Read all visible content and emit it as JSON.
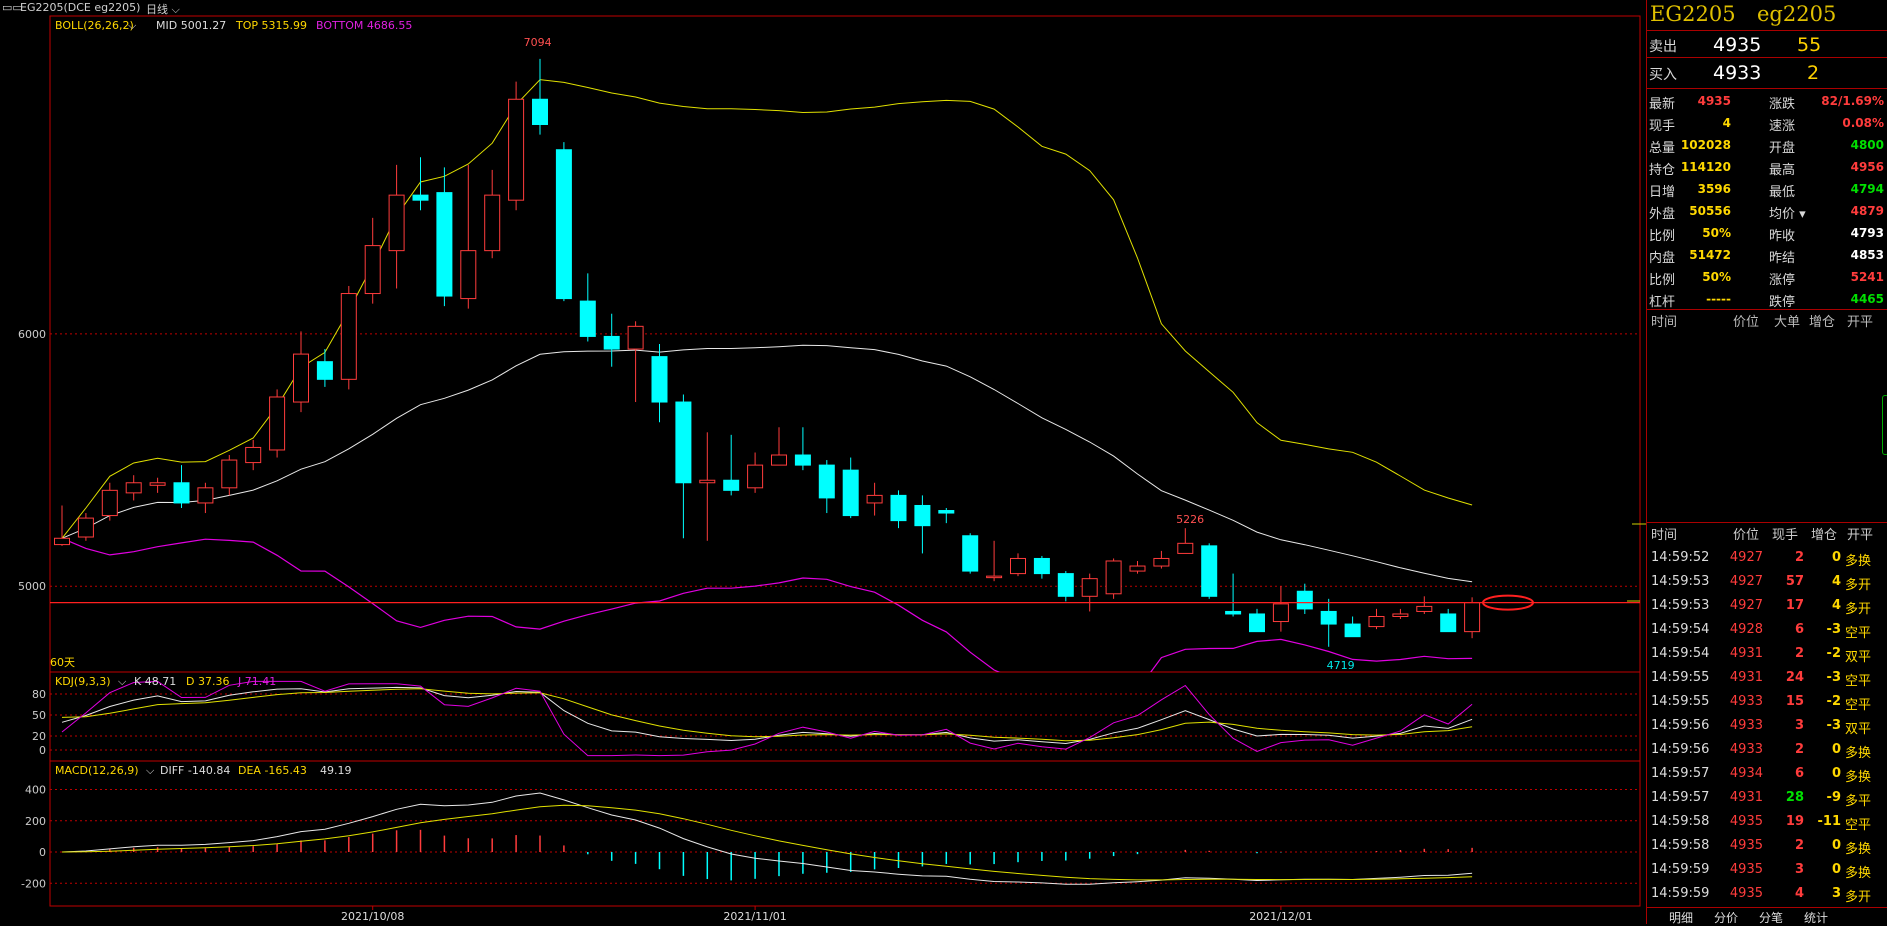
{
  "window": {
    "symbol_line": "EG2205(DCE eg2205)",
    "period": "日线"
  },
  "colors": {
    "up": "#ff3c3c",
    "down": "#00ffff",
    "mid": "#e8e8e8",
    "top": "#e0e000",
    "bottom": "#e000e0",
    "grid": "#c00000",
    "label_yellow": "#ffd800",
    "label_green": "#00e000"
  },
  "chart_data": {
    "type": "candlestick",
    "x_labels": [
      {
        "i": 13,
        "label": "2021/10/08"
      },
      {
        "i": 29,
        "label": "2021/11/01"
      },
      {
        "i": 51,
        "label": "2021/12/01"
      }
    ],
    "price_axis": {
      "ticks": [
        "6000",
        "5000"
      ],
      "range": [
        4660,
        7260
      ]
    },
    "boll": {
      "title": "BOLL(26,26,2)",
      "mid_label": "MID 5001.27",
      "top_label": "TOP 5315.99",
      "bottom_label": "BOTTOM 4686.55"
    },
    "annotations": {
      "high": "7094",
      "high2": "5226",
      "low": "4719"
    },
    "bottom_note": "60天",
    "candles": [
      [
        5165,
        5190,
        5320,
        5160
      ],
      [
        5195,
        5270,
        5290,
        5180
      ],
      [
        5280,
        5380,
        5410,
        5260
      ],
      [
        5370,
        5410,
        5440,
        5340
      ],
      [
        5400,
        5410,
        5430,
        5370
      ],
      [
        5410,
        5330,
        5480,
        5310
      ],
      [
        5330,
        5390,
        5410,
        5290
      ],
      [
        5390,
        5500,
        5520,
        5360
      ],
      [
        5490,
        5550,
        5580,
        5460
      ],
      [
        5540,
        5750,
        5780,
        5510
      ],
      [
        5730,
        5920,
        6010,
        5690
      ],
      [
        5890,
        5820,
        5940,
        5790
      ],
      [
        5820,
        6160,
        6190,
        5780
      ],
      [
        6160,
        6350,
        6460,
        6120
      ],
      [
        6330,
        6550,
        6670,
        6180
      ],
      [
        6550,
        6530,
        6700,
        6490
      ],
      [
        6560,
        6150,
        6660,
        6110
      ],
      [
        6140,
        6330,
        6670,
        6100
      ],
      [
        6330,
        6550,
        6650,
        6300
      ],
      [
        6530,
        6930,
        7000,
        6490
      ],
      [
        6930,
        6830,
        7090,
        6790
      ],
      [
        6730,
        6140,
        6760,
        6130
      ],
      [
        6130,
        5990,
        6240,
        5970
      ],
      [
        5990,
        5940,
        6080,
        5870
      ],
      [
        5940,
        6030,
        6050,
        5730
      ],
      [
        5910,
        5730,
        5960,
        5650
      ],
      [
        5730,
        5410,
        5760,
        5190
      ],
      [
        5410,
        5420,
        5610,
        5180
      ],
      [
        5420,
        5380,
        5600,
        5360
      ],
      [
        5390,
        5480,
        5530,
        5370
      ],
      [
        5480,
        5520,
        5630,
        5490
      ],
      [
        5520,
        5480,
        5630,
        5460
      ],
      [
        5480,
        5350,
        5500,
        5290
      ],
      [
        5460,
        5280,
        5510,
        5270
      ],
      [
        5330,
        5360,
        5410,
        5280
      ],
      [
        5360,
        5260,
        5380,
        5230
      ],
      [
        5320,
        5240,
        5360,
        5130
      ],
      [
        5300,
        5290,
        5310,
        5250
      ],
      [
        5200,
        5060,
        5210,
        5050
      ],
      [
        5040,
        5040,
        5180,
        5020
      ],
      [
        5050,
        5110,
        5130,
        5040
      ],
      [
        5110,
        5050,
        5120,
        5030
      ],
      [
        5050,
        4960,
        5060,
        4940
      ],
      [
        4960,
        5030,
        5050,
        4900
      ],
      [
        4970,
        5100,
        5110,
        4950
      ],
      [
        5060,
        5080,
        5100,
        5050
      ],
      [
        5080,
        5110,
        5140,
        5070
      ],
      [
        5130,
        5170,
        5230,
        5130
      ],
      [
        5160,
        4960,
        5170,
        4950
      ],
      [
        4900,
        4890,
        5050,
        4880
      ],
      [
        4890,
        4820,
        4910,
        4820
      ],
      [
        4860,
        4930,
        5000,
        4820
      ],
      [
        4980,
        4910,
        5010,
        4890
      ],
      [
        4900,
        4850,
        4950,
        4760
      ],
      [
        4850,
        4800,
        4880,
        4800
      ],
      [
        4840,
        4880,
        4910,
        4830
      ],
      [
        4880,
        4890,
        4910,
        4870
      ],
      [
        4900,
        4920,
        4960,
        4890
      ],
      [
        4890,
        4820,
        4910,
        4820
      ],
      [
        4820,
        4935,
        4956,
        4794
      ]
    ],
    "kdj": {
      "title": "KDJ(9,3,3)",
      "k_label": "K 48.71",
      "d_label": "D 37.36",
      "j_label": "J 71.41",
      "ticks": [
        "80",
        "50",
        "20",
        "0"
      ],
      "range": [
        -10,
        100
      ]
    },
    "macd": {
      "title": "MACD(12,26,9)",
      "diff_label": "DIFF -140.84",
      "dea_label": "DEA -165.43",
      "macd_label": "49.19",
      "ticks": [
        "400",
        "200",
        "0",
        "-200"
      ],
      "range": [
        -320,
        480
      ]
    }
  },
  "quote": {
    "code": "EG2205",
    "name": "eg2205",
    "sell_label": "卖出",
    "sell_price": "4935",
    "sell_vol": "55",
    "buy_label": "买入",
    "buy_price": "4933",
    "buy_vol": "2",
    "stats": [
      {
        "l": "最新",
        "v": "4935",
        "c": "red",
        "l2": "涨跌",
        "v2": "82/1.69%",
        "c2": "red"
      },
      {
        "l": "现手",
        "v": "4",
        "c": "ylw",
        "l2": "速涨",
        "v2": "0.08%",
        "c2": "red"
      },
      {
        "l": "总量",
        "v": "102028",
        "c": "ylw",
        "l2": "开盘",
        "v2": "4800",
        "c2": "grn"
      },
      {
        "l": "持仓",
        "v": "114120",
        "c": "ylw",
        "l2": "最高",
        "v2": "4956",
        "c2": "red"
      },
      {
        "l": "日增",
        "v": "3596",
        "c": "ylw",
        "l2": "最低",
        "v2": "4794",
        "c2": "grn"
      },
      {
        "l": "外盘",
        "v": "50556",
        "c": "ylw",
        "l2": "均价",
        "v2": "4879",
        "c2": "red"
      },
      {
        "l": "比例",
        "v": "50%",
        "c": "ylw",
        "l2": "昨收",
        "v2": "4793",
        "c2": "wht"
      },
      {
        "l": "内盘",
        "v": "51472",
        "c": "ylw",
        "l2": "昨结",
        "v2": "4853",
        "c2": "wht"
      },
      {
        "l": "比例",
        "v": "50%",
        "c": "ylw",
        "l2": "涨停",
        "v2": "5241",
        "c2": "red"
      },
      {
        "l": "杠杆",
        "v": "-----",
        "c": "ylw",
        "l2": "跌停",
        "v2": "4465",
        "c2": "grn"
      }
    ],
    "big_header": {
      "time": "时间",
      "price": "价位",
      "big": "大单",
      "oi": "增仓",
      "open": "开平"
    },
    "tick_header": {
      "time": "时间",
      "price": "价位",
      "hand": "现手",
      "oi": "增仓",
      "open": "开平"
    },
    "ticks": [
      {
        "t": "14:59:52",
        "p": "4927",
        "h": "2",
        "hc": "red",
        "o": "0",
        "oc": "ylw",
        "k": "多换",
        "kc": "ylw"
      },
      {
        "t": "14:59:53",
        "p": "4927",
        "h": "57",
        "hc": "red",
        "o": "4",
        "oc": "ylw",
        "k": "多开",
        "kc": "ylw"
      },
      {
        "t": "14:59:53",
        "p": "4927",
        "h": "17",
        "hc": "red",
        "o": "4",
        "oc": "ylw",
        "k": "多开",
        "kc": "ylw"
      },
      {
        "t": "14:59:54",
        "p": "4928",
        "h": "6",
        "hc": "red",
        "o": "-3",
        "oc": "ylw",
        "k": "空平",
        "kc": "ylw"
      },
      {
        "t": "14:59:54",
        "p": "4931",
        "h": "2",
        "hc": "red",
        "o": "-2",
        "oc": "ylw",
        "k": "双平",
        "kc": "ylw"
      },
      {
        "t": "14:59:55",
        "p": "4931",
        "h": "24",
        "hc": "red",
        "o": "-3",
        "oc": "ylw",
        "k": "空平",
        "kc": "ylw"
      },
      {
        "t": "14:59:55",
        "p": "4933",
        "h": "15",
        "hc": "red",
        "o": "-2",
        "oc": "ylw",
        "k": "空平",
        "kc": "ylw"
      },
      {
        "t": "14:59:56",
        "p": "4933",
        "h": "3",
        "hc": "red",
        "o": "-3",
        "oc": "ylw",
        "k": "双平",
        "kc": "ylw"
      },
      {
        "t": "14:59:56",
        "p": "4933",
        "h": "2",
        "hc": "red",
        "o": "0",
        "oc": "ylw",
        "k": "多换",
        "kc": "ylw"
      },
      {
        "t": "14:59:57",
        "p": "4934",
        "h": "6",
        "hc": "red",
        "o": "0",
        "oc": "ylw",
        "k": "多换",
        "kc": "ylw"
      },
      {
        "t": "14:59:57",
        "p": "4931",
        "h": "28",
        "hc": "grn",
        "o": "-9",
        "oc": "ylw",
        "k": "多平",
        "kc": "ylw"
      },
      {
        "t": "14:59:58",
        "p": "4935",
        "h": "19",
        "hc": "red",
        "o": "-11",
        "oc": "ylw",
        "k": "空平",
        "kc": "ylw"
      },
      {
        "t": "14:59:58",
        "p": "4935",
        "h": "2",
        "hc": "red",
        "o": "0",
        "oc": "ylw",
        "k": "多换",
        "kc": "ylw"
      },
      {
        "t": "14:59:59",
        "p": "4935",
        "h": "3",
        "hc": "red",
        "o": "0",
        "oc": "ylw",
        "k": "多换",
        "kc": "ylw"
      },
      {
        "t": "14:59:59",
        "p": "4935",
        "h": "4",
        "hc": "red",
        "o": "3",
        "oc": "ylw",
        "k": "多开",
        "kc": "ylw"
      }
    ],
    "tabs": [
      "明细",
      "分价",
      "分笔",
      "统计"
    ]
  }
}
